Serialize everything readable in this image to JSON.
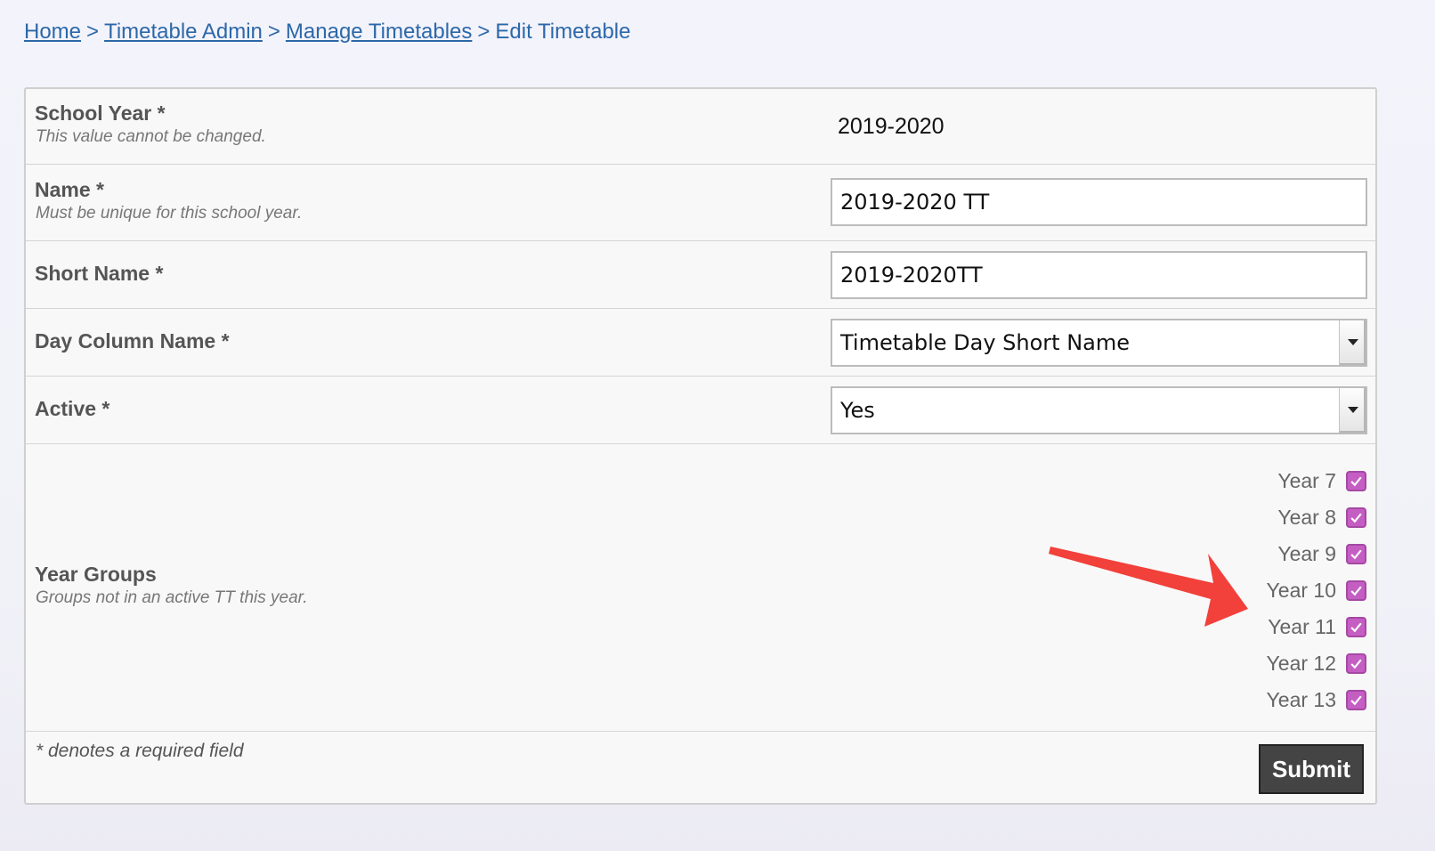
{
  "breadcrumb": {
    "items": [
      {
        "label": "Home"
      },
      {
        "label": "Timetable Admin"
      },
      {
        "label": "Manage Timetables"
      }
    ],
    "separator": ">",
    "current": "Edit Timetable"
  },
  "form": {
    "school_year": {
      "title": "School Year *",
      "description": "This value cannot be changed.",
      "value": "2019-2020"
    },
    "name": {
      "title": "Name *",
      "description": "Must be unique for this school year.",
      "value": "2019-2020 TT"
    },
    "short_name": {
      "title": "Short Name *",
      "value": "2019-2020TT"
    },
    "day_column_name": {
      "title": "Day Column Name *",
      "selected": "Timetable Day Short Name"
    },
    "active": {
      "title": "Active *",
      "selected": "Yes"
    },
    "year_groups": {
      "title": "Year Groups",
      "description": "Groups not in an active TT this year.",
      "options": [
        {
          "label": "Year 7",
          "checked": true
        },
        {
          "label": "Year 8",
          "checked": true
        },
        {
          "label": "Year 9",
          "checked": true
        },
        {
          "label": "Year 10",
          "checked": true
        },
        {
          "label": "Year 11",
          "checked": true
        },
        {
          "label": "Year 12",
          "checked": true
        },
        {
          "label": "Year 13",
          "checked": true
        }
      ]
    },
    "footer_note": "* denotes a required field",
    "submit_label": "Submit"
  },
  "colors": {
    "link": "#2c68a8",
    "checkbox": "#c55ec2",
    "annotation_arrow": "#f2403a",
    "submit_bg": "#444444"
  },
  "annotation": {
    "icon": "red-arrow-icon"
  }
}
